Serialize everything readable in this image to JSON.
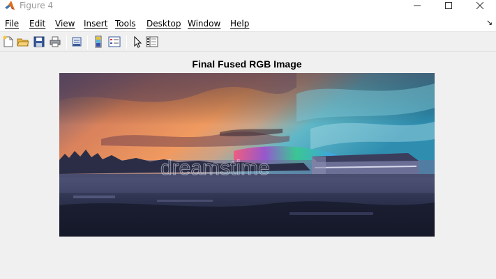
{
  "window": {
    "title": "Figure 4",
    "controls": {
      "minimize": "minimize-icon",
      "maximize": "maximize-icon",
      "close": "close-icon"
    }
  },
  "menu": [
    {
      "label": "File"
    },
    {
      "label": "Edit"
    },
    {
      "label": "View"
    },
    {
      "label": "Insert"
    },
    {
      "label": "Tools"
    },
    {
      "label": "Desktop"
    },
    {
      "label": "Window"
    },
    {
      "label": "Help"
    }
  ],
  "menu_dock_icon": "dock-arrow-icon",
  "toolbar": [
    {
      "icon": "new-figure-icon"
    },
    {
      "icon": "open-file-icon"
    },
    {
      "icon": "save-icon"
    },
    {
      "icon": "print-icon"
    },
    {
      "icon": "link-plot-icon"
    },
    {
      "icon": "insert-colorbar-icon"
    },
    {
      "icon": "insert-legend-icon"
    },
    {
      "icon": "edit-plot-icon"
    },
    {
      "icon": "property-inspector-icon"
    }
  ],
  "figure": {
    "title": "Final Fused RGB Image",
    "watermark": "dreamstime"
  },
  "colors": {
    "background": "#f0f0f0",
    "titlebar": "#ffffff",
    "sky_orange": "#e8895a",
    "sky_cyan": "#37a8c4",
    "ground_dark": "#1f2438"
  }
}
